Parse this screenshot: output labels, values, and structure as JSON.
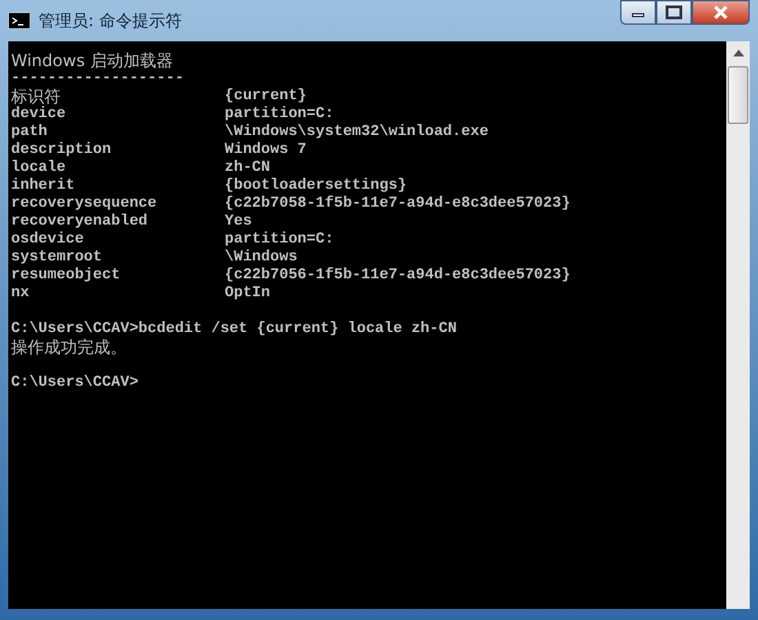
{
  "window": {
    "title": "管理员: 命令提示符"
  },
  "console": {
    "header": "Windows 启动加载器",
    "separator": "-------------------",
    "entries": [
      {
        "key": "标识符",
        "value": "{current}"
      },
      {
        "key": "device",
        "value": "partition=C:"
      },
      {
        "key": "path",
        "value": "\\Windows\\system32\\winload.exe"
      },
      {
        "key": "description",
        "value": "Windows 7"
      },
      {
        "key": "locale",
        "value": "zh-CN"
      },
      {
        "key": "inherit",
        "value": "{bootloadersettings}"
      },
      {
        "key": "recoverysequence",
        "value": "{c22b7058-1f5b-11e7-a94d-e8c3dee57023}"
      },
      {
        "key": "recoveryenabled",
        "value": "Yes"
      },
      {
        "key": "osdevice",
        "value": "partition=C:"
      },
      {
        "key": "systemroot",
        "value": "\\Windows"
      },
      {
        "key": "resumeobject",
        "value": "{c22b7056-1f5b-11e7-a94d-e8c3dee57023}"
      },
      {
        "key": "nx",
        "value": "OptIn"
      }
    ],
    "output": [
      {
        "kind": "blank"
      },
      {
        "kind": "line",
        "text": "C:\\Users\\CCAV>bcdedit /set {current} locale zh-CN"
      },
      {
        "kind": "line",
        "text": "操作成功完成。"
      },
      {
        "kind": "blank"
      },
      {
        "kind": "line",
        "text": "C:\\Users\\CCAV>"
      }
    ]
  }
}
